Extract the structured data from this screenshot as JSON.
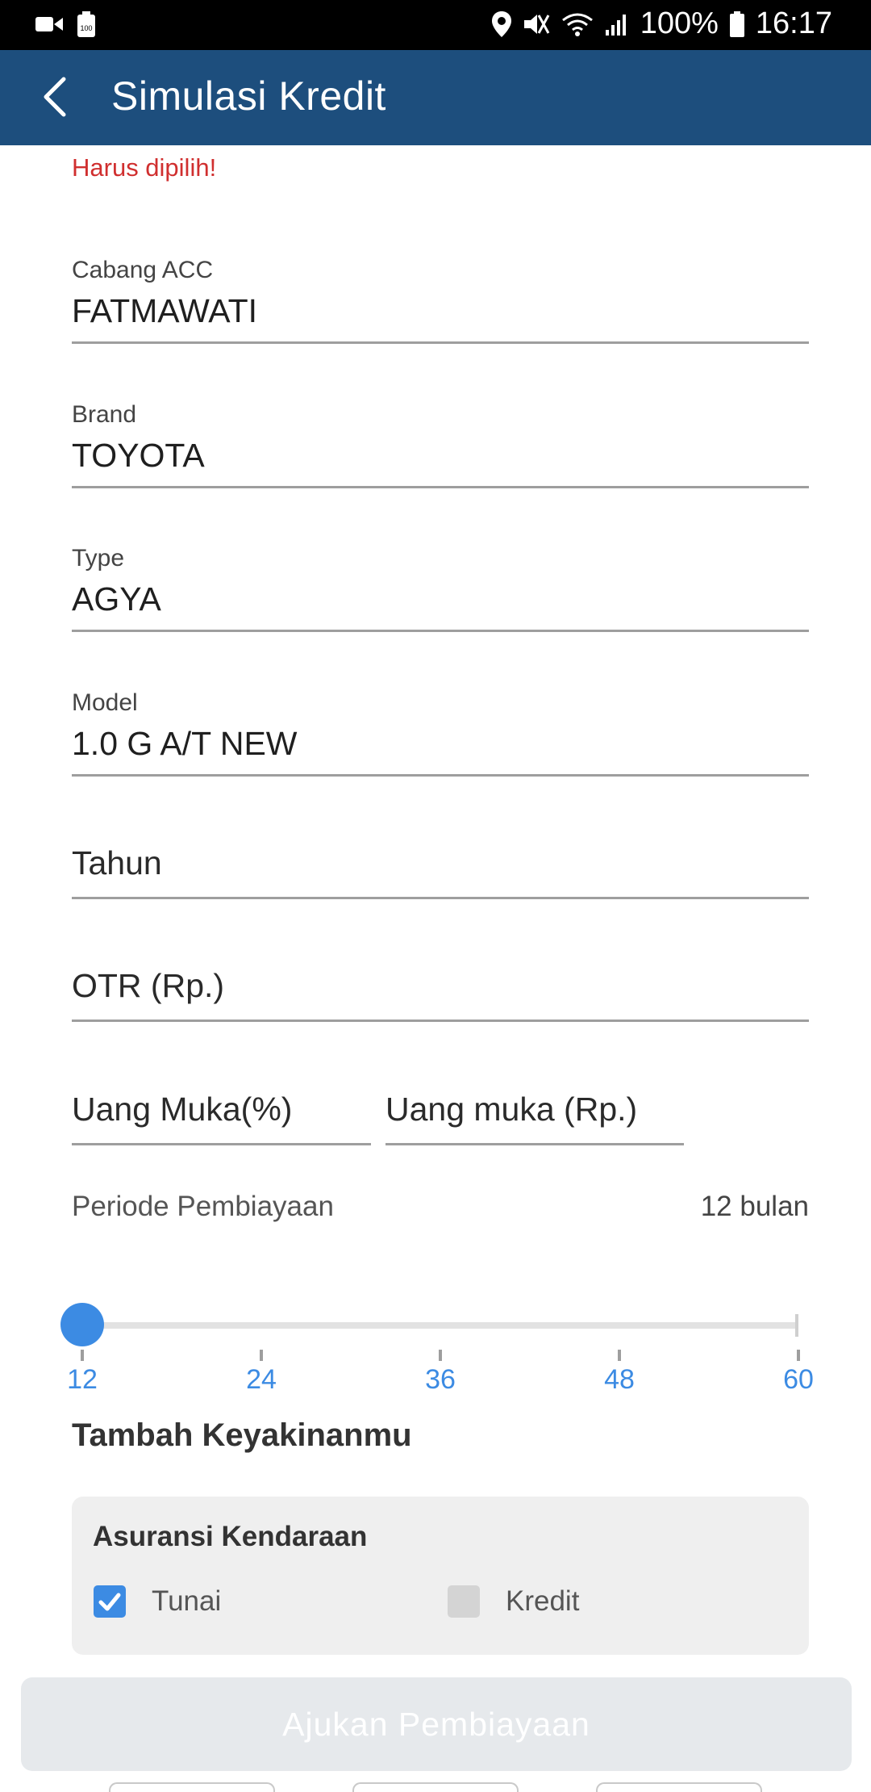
{
  "status_bar": {
    "battery_percent": "100%",
    "time": "16:17",
    "icons": [
      "video-call-icon",
      "battery-saver-icon",
      "location-icon",
      "mute-icon",
      "wifi-icon",
      "signal-icon",
      "battery-icon"
    ]
  },
  "app_bar": {
    "title": "Simulasi Kredit"
  },
  "form": {
    "error_text": "Harus dipilih!",
    "cabang": {
      "label": "Cabang ACC",
      "value": "FATMAWATI"
    },
    "brand": {
      "label": "Brand",
      "value": "TOYOTA"
    },
    "type": {
      "label": "Type",
      "value": "AGYA"
    },
    "model": {
      "label": "Model",
      "value": "1.0 G A/T NEW"
    },
    "tahun": {
      "placeholder": "Tahun"
    },
    "otr": {
      "placeholder": "OTR (Rp.)"
    },
    "uang_muka_pct": {
      "placeholder": "Uang Muka(%)"
    },
    "uang_muka_rp": {
      "placeholder": "Uang muka (Rp.)"
    }
  },
  "periode": {
    "label": "Periode Pembiayaan",
    "value_text": "12 bulan",
    "selected": 12,
    "ticks": [
      "12",
      "24",
      "36",
      "48",
      "60"
    ]
  },
  "section": {
    "title": "Tambah Keyakinanmu"
  },
  "insurance": {
    "title": "Asuransi Kendaraan",
    "options": [
      {
        "label": "Tunai",
        "checked": true
      },
      {
        "label": "Kredit",
        "checked": false
      }
    ]
  },
  "submit": {
    "label": "Ajukan Pembiayaan",
    "enabled": false
  },
  "colors": {
    "app_bar": "#1d4e7d",
    "accent": "#3c8be3",
    "error": "#d02f2f",
    "button_disabled": "#e6e9ec"
  }
}
